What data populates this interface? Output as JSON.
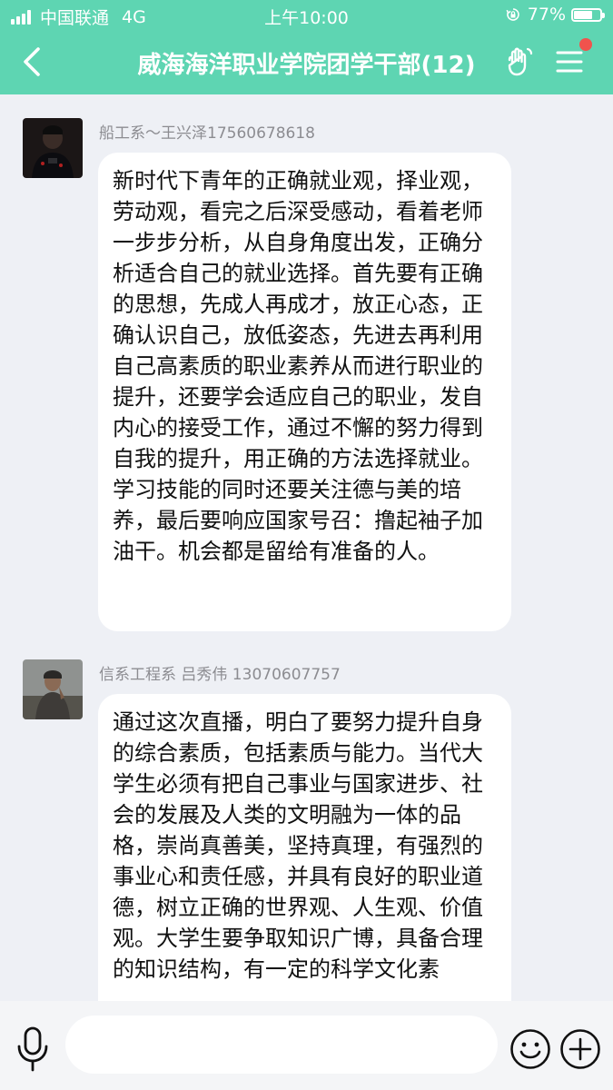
{
  "status_bar": {
    "carrier": "中国联通",
    "network": "4G",
    "time": "上午10:00",
    "battery_text": "77%",
    "battery_level": 0.77
  },
  "header": {
    "title": "威海海洋职业学院团学干部(12)"
  },
  "messages": [
    {
      "sender": "船工系～王兴泽17560678618",
      "text": "新时代下青年的正确就业观，择业观，劳动观，看完之后深受感动，看着老师一步步分析，从自身角度出发，正确分析适合自己的就业选择。首先要有正确的思想，先成人再成才，放正心态，正确认识自己，放低姿态，先进去再利用自己高素质的职业素养从而进行职业的提升，还要学会适应自己的职业，发自内心的接受工作，通过不懈的努力得到自我的提升，用正确的方法选择就业。学习技能的同时还要关注德与美的培养，最后要响应国家号召：撸起袖子加油干。机会都是留给有准备的人。"
    },
    {
      "sender": "信系工程系 吕秀伟 13070607757",
      "text": "通过这次直播，明白了要努力提升自身的综合素质，包括素质与能力。当代大学生必须有把自己事业与国家进步、社会的发展及人类的文明融为一体的品格，崇尚真善美，坚持真理，有强烈的事业心和责任感，并具有良好的职业道德，树立正确的世界观、人生观、价值观。大学生要争取知识广博，具备合理的知识结构，有一定的科学文化素"
    }
  ],
  "input_bar": {
    "placeholder": ""
  }
}
